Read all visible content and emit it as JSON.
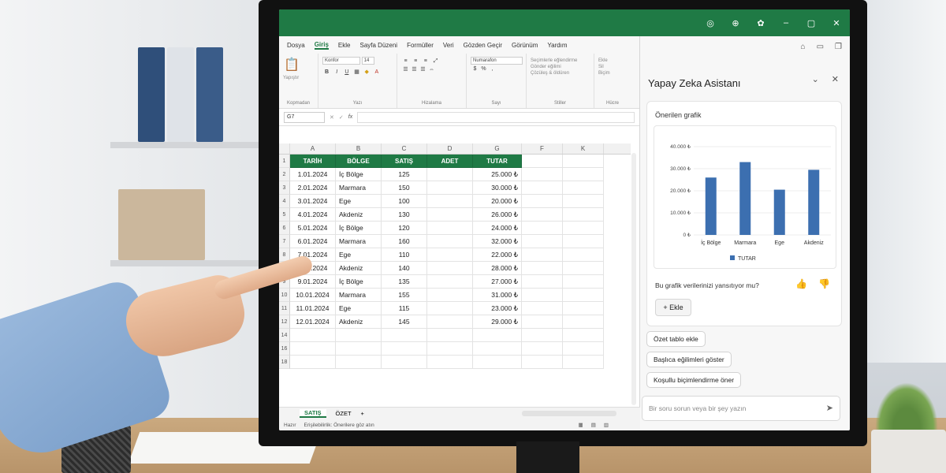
{
  "window": {
    "ribbon_tabs": [
      "Dosya",
      "Giriş",
      "Ekle",
      "Sayfa Düzeni",
      "Formüller",
      "Veri",
      "Gözden Geçir",
      "Görünüm",
      "Yardım"
    ],
    "active_tab": "Giriş",
    "title_controls": [
      "–",
      "▢",
      "✕"
    ]
  },
  "ribbon": {
    "clipboard": {
      "paste": "Yapıştır",
      "label": "Kopmadan"
    },
    "font": {
      "name": "Konfor",
      "size": "14",
      "label": "Yazı"
    },
    "alignment": {
      "label": "Hizalama"
    },
    "number": {
      "format": "Numarafon",
      "label": "Sayı"
    },
    "styles": {
      "items": [
        "Seçimlerle eğlendirme",
        "Gönder eğilimi",
        "Çözüleş & öldüren"
      ],
      "label": "Stiller"
    },
    "cells": {
      "items": [
        "Ekle",
        "Sil",
        "Biçim"
      ],
      "label": "Hücre"
    }
  },
  "formula_bar": {
    "name_box": "G7",
    "fx": "fx",
    "value": ""
  },
  "sheet": {
    "columns": [
      "A",
      "B",
      "C",
      "D",
      "G",
      "F",
      "K"
    ],
    "headers": [
      "TARİH",
      "BÖLGE",
      "SATIŞ",
      "ADET",
      "TUTAR"
    ],
    "rows": [
      {
        "n": "2",
        "date": "1.01.2024",
        "region": "İç Bölge",
        "sales": "125",
        "qty": "",
        "amount": "25.000 ₺"
      },
      {
        "n": "3",
        "date": "2.01.2024",
        "region": "Marmara",
        "sales": "150",
        "qty": "",
        "amount": "30.000 ₺"
      },
      {
        "n": "4",
        "date": "3.01.2024",
        "region": "Ege",
        "sales": "100",
        "qty": "",
        "amount": "20.000 ₺"
      },
      {
        "n": "5",
        "date": "4.01.2024",
        "region": "Akdeniz",
        "sales": "130",
        "qty": "",
        "amount": "26.000 ₺"
      },
      {
        "n": "6",
        "date": "5.01.2024",
        "region": "İç Bölge",
        "sales": "120",
        "qty": "",
        "amount": "24.000 ₺"
      },
      {
        "n": "7",
        "date": "6.01.2024",
        "region": "Marmara",
        "sales": "160",
        "qty": "",
        "amount": "32.000 ₺"
      },
      {
        "n": "8",
        "date": "7.01.2024",
        "region": "Ege",
        "sales": "110",
        "qty": "",
        "amount": "22.000 ₺"
      },
      {
        "n": "9",
        "date": "8.01.2024",
        "region": "Akdeniz",
        "sales": "140",
        "qty": "",
        "amount": "28.000 ₺"
      },
      {
        "n": "9",
        "date": "9.01.2024",
        "region": "İç Bölge",
        "sales": "135",
        "qty": "",
        "amount": "27.000 ₺"
      },
      {
        "n": "10",
        "date": "10.01.2024",
        "region": "Marmara",
        "sales": "155",
        "qty": "",
        "amount": "31.000 ₺"
      },
      {
        "n": "11",
        "date": "11.01.2024",
        "region": "Ege",
        "sales": "115",
        "qty": "",
        "amount": "23.000 ₺"
      },
      {
        "n": "12",
        "date": "12.01.2024",
        "region": "Akdeniz",
        "sales": "145",
        "qty": "",
        "amount": "29.000 ₺"
      }
    ],
    "header_row_number": "1",
    "empty_row_numbers": [
      "14",
      "16",
      "18"
    ],
    "tabs": [
      "SATIŞ",
      "ÖZET"
    ],
    "add_sheet": "+",
    "status": {
      "ready": "Hazır",
      "accessibility": "Erişilebilirlik: Önerilere göz atın"
    }
  },
  "assistant": {
    "title": "Yapay Zeka Asistanı",
    "suggested_label": "Önerilen grafik",
    "question": "Bu grafik verilerinizi yansıtıyor mu?",
    "add_button": "Ekle",
    "chips": [
      "Özet tablo ekle",
      "Başlıca eğilimleri göster",
      "Koşullu biçimlendirme öner"
    ],
    "ask_placeholder": "Bir soru sorun veya bir şey yazın"
  },
  "chart_data": {
    "type": "bar",
    "categories": [
      "İç Bölge",
      "Marmara",
      "Ege",
      "Akdeniz"
    ],
    "series": [
      {
        "name": "TUTAR",
        "values": [
          26000,
          33000,
          20500,
          29500
        ]
      }
    ],
    "yticks": [
      "0 ₺",
      "10.000 ₺",
      "20.000 ₺",
      "30.000 ₺",
      "40.000 ₺"
    ],
    "ylim": [
      0,
      40000
    ],
    "legend": "bottom",
    "bar_color": "#3c6fb0"
  },
  "colors": {
    "accent": "#1f7a45",
    "bar": "#3c6fb0"
  }
}
